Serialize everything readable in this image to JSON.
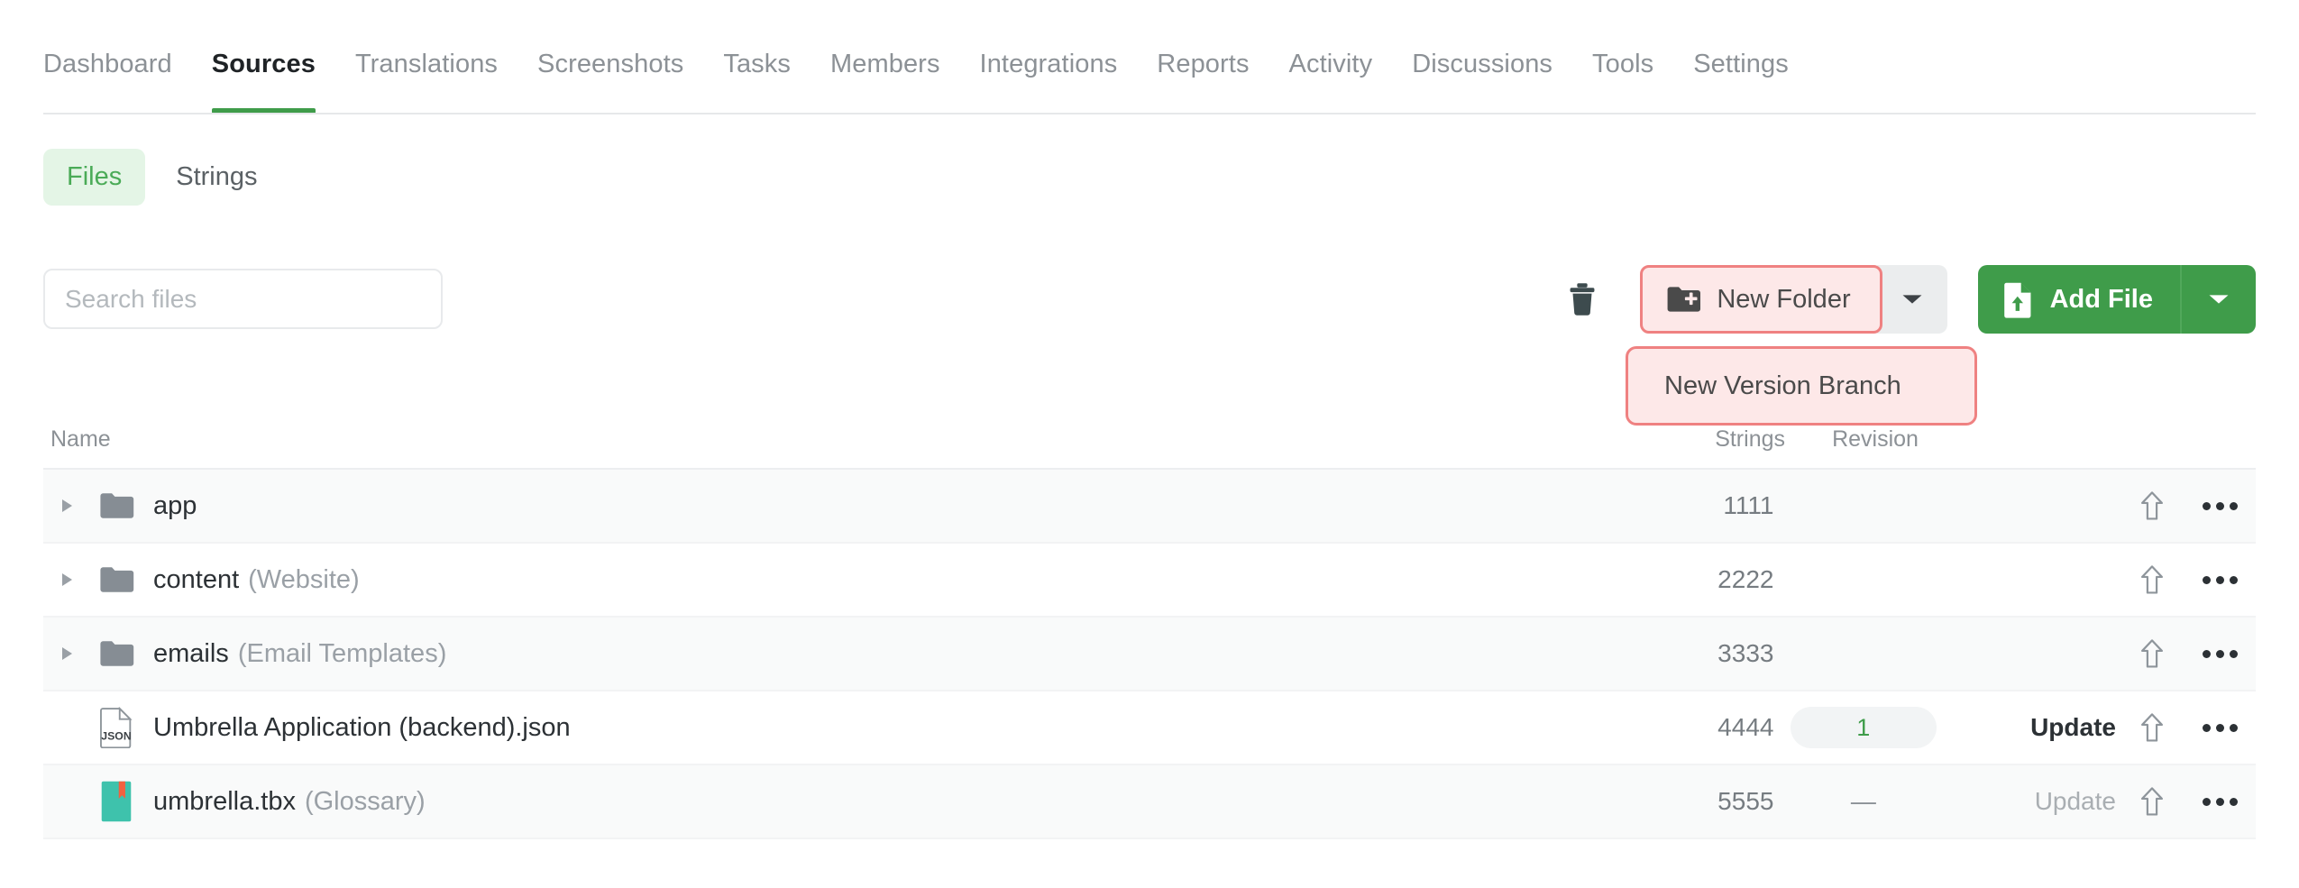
{
  "nav": {
    "tabs": [
      {
        "label": "Dashboard",
        "active": false
      },
      {
        "label": "Sources",
        "active": true
      },
      {
        "label": "Translations",
        "active": false
      },
      {
        "label": "Screenshots",
        "active": false
      },
      {
        "label": "Tasks",
        "active": false
      },
      {
        "label": "Members",
        "active": false
      },
      {
        "label": "Integrations",
        "active": false
      },
      {
        "label": "Reports",
        "active": false
      },
      {
        "label": "Activity",
        "active": false
      },
      {
        "label": "Discussions",
        "active": false
      },
      {
        "label": "Tools",
        "active": false
      },
      {
        "label": "Settings",
        "active": false
      }
    ]
  },
  "segmented": {
    "files_label": "Files",
    "strings_label": "Strings"
  },
  "search": {
    "placeholder": "Search files",
    "value": ""
  },
  "toolbar": {
    "delete_icon": "trash-icon",
    "new_folder_label": "New Folder",
    "new_folder_icon": "folder-plus-icon",
    "new_folder_caret_icon": "chevron-down-icon",
    "add_file_label": "Add File",
    "add_file_icon": "file-upload-icon",
    "add_file_caret_icon": "chevron-down-icon"
  },
  "dropdown": {
    "items": [
      {
        "label": "New Version Branch"
      }
    ]
  },
  "table": {
    "columns": {
      "name": "Name",
      "strings": "Strings",
      "revision": "Revision"
    },
    "rows": [
      {
        "icon": "folder-icon",
        "expandable": true,
        "name": "app",
        "meta": "",
        "strings": "1111",
        "revision": "",
        "revision_kind": "none",
        "update": "",
        "update_state": "none"
      },
      {
        "icon": "folder-icon",
        "expandable": true,
        "name": "content",
        "meta": "(Website)",
        "strings": "2222",
        "revision": "",
        "revision_kind": "none",
        "update": "",
        "update_state": "none"
      },
      {
        "icon": "folder-icon",
        "expandable": true,
        "name": "emails",
        "meta": "(Email Templates)",
        "strings": "3333",
        "revision": "",
        "revision_kind": "none",
        "update": "",
        "update_state": "none"
      },
      {
        "icon": "json-file-icon",
        "expandable": false,
        "name": "Umbrella Application (backend).json",
        "meta": "",
        "strings": "4444",
        "revision": "1",
        "revision_kind": "badge",
        "update": "Update",
        "update_state": "enabled"
      },
      {
        "icon": "glossary-icon",
        "expandable": false,
        "name": "umbrella.tbx",
        "meta": "(Glossary)",
        "strings": "5555",
        "revision": "—",
        "revision_kind": "dash",
        "update": "Update",
        "update_state": "disabled"
      }
    ],
    "row_icons": {
      "upload": "upload-arrow-icon",
      "more": "more-options-icon"
    }
  },
  "colors": {
    "accent_green": "#3f9c4a",
    "highlight_border": "#ef8181",
    "highlight_fill": "#fde8e8",
    "segment_active_bg": "#e4f5e6",
    "segment_active_text": "#4aab57"
  }
}
